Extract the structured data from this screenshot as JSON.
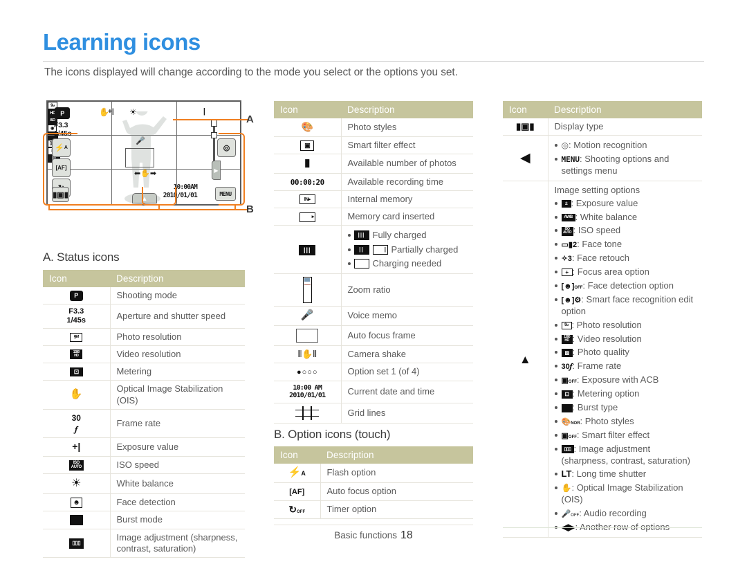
{
  "page": {
    "title": "Learning icons",
    "intro": "The icons displayed will change according to the mode you select or the options you set.",
    "footer_label": "Basic functions",
    "footer_page": "18",
    "accent_color": "#2f8fe0",
    "callout_color": "#f07f20",
    "table_header_color": "#c6c59d"
  },
  "camera_screen": {
    "mode_badge": "P",
    "aperture": "F3.3",
    "shutter": "1/45s",
    "time": "10:00AM",
    "date": "2010/01/01",
    "menu_button": "MENU",
    "motion_button": "motion-recognition",
    "flash_button": "A",
    "af_button": "AF",
    "timer_button": "OFF",
    "display_button": "display-type",
    "callout_a": "A",
    "callout_b": "B"
  },
  "sections": {
    "a_heading": "A. Status icons",
    "b_heading": "B. Option icons (touch)"
  },
  "table_headers": {
    "icon": "Icon",
    "description": "Description"
  },
  "status_icons": [
    {
      "icon": "shooting-mode",
      "text": "Shooting mode"
    },
    {
      "icon": "aperture-shutter",
      "text": "Aperture and shutter speed"
    },
    {
      "icon": "photo-resolution",
      "text": "Photo resolution"
    },
    {
      "icon": "video-resolution",
      "text": "Video resolution"
    },
    {
      "icon": "metering",
      "text": "Metering"
    },
    {
      "icon": "ois",
      "text": "Optical Image Stabilization (OIS)"
    },
    {
      "icon": "frame-rate",
      "text": "Frame rate"
    },
    {
      "icon": "exposure-value",
      "text": "Exposure value"
    },
    {
      "icon": "iso-speed",
      "text": "ISO speed"
    },
    {
      "icon": "white-balance",
      "text": "White balance"
    },
    {
      "icon": "face-detection",
      "text": "Face detection"
    },
    {
      "icon": "burst-mode",
      "text": "Burst mode"
    },
    {
      "icon": "image-adjust",
      "text": "Image adjustment (sharpness, contrast, saturation)"
    }
  ],
  "middle_icons": [
    {
      "icon": "photo-styles",
      "text": "Photo styles"
    },
    {
      "icon": "smart-filter",
      "text": "Smart filter effect"
    },
    {
      "icon": "available-photos",
      "text": "Available number of photos"
    },
    {
      "icon": "recording-time",
      "text": "Available recording time",
      "icon_text": "00:00:20"
    },
    {
      "icon": "internal-memory",
      "text": "Internal memory"
    },
    {
      "icon": "memory-card",
      "text": "Memory card inserted"
    },
    {
      "icon": "battery",
      "text": "",
      "sub": [
        {
          "label": "Fully charged"
        },
        {
          "label": "Partially charged"
        },
        {
          "label": "Charging needed"
        }
      ]
    },
    {
      "icon": "zoom-ratio",
      "text": "Zoom ratio"
    },
    {
      "icon": "voice-memo",
      "text": "Voice memo"
    },
    {
      "icon": "auto-focus-frame",
      "text": "Auto focus frame"
    },
    {
      "icon": "camera-shake",
      "text": "Camera shake"
    },
    {
      "icon": "option-set",
      "text": "Option set 1 (of 4)"
    },
    {
      "icon": "date-time",
      "text": "Current date and time",
      "icon_text_1": "10:00 AM",
      "icon_text_2": "2010/01/01"
    },
    {
      "icon": "grid-lines",
      "text": "Grid lines"
    }
  ],
  "option_icons": [
    {
      "icon": "flash-option",
      "text": "Flash option"
    },
    {
      "icon": "auto-focus-option",
      "text": "Auto focus option"
    },
    {
      "icon": "timer-option",
      "text": "Timer option"
    }
  ],
  "right_icons": [
    {
      "icon": "display-type",
      "text": "Display type"
    },
    {
      "icon": "left-arrow",
      "sub": [
        {
          "icon": "motion-recognition",
          "text": "Motion recognition"
        },
        {
          "icon": "menu",
          "text": "Shooting options and settings menu"
        }
      ]
    },
    {
      "icon": "up-arrow",
      "intro": "Image setting options",
      "sub": [
        {
          "icon": "exposure-value",
          "text": "Exposure value"
        },
        {
          "icon": "white-balance-awb",
          "text": "White balance"
        },
        {
          "icon": "iso-speed",
          "text": "ISO speed"
        },
        {
          "icon": "face-tone",
          "text": "Face tone"
        },
        {
          "icon": "face-retouch",
          "text": "Face retouch"
        },
        {
          "icon": "focus-area",
          "text": "Focus area option"
        },
        {
          "icon": "face-detection-option",
          "text": "Face detection option"
        },
        {
          "icon": "smart-face-recognition",
          "text": "Smart face recognition edit option"
        },
        {
          "icon": "photo-resolution",
          "text": "Photo resolution"
        },
        {
          "icon": "video-resolution",
          "text": "Video resolution"
        },
        {
          "icon": "photo-quality",
          "text": "Photo quality"
        },
        {
          "icon": "frame-rate",
          "text": "Frame rate"
        },
        {
          "icon": "exposure-acb",
          "text": "Exposure with ACB"
        },
        {
          "icon": "metering-option",
          "text": "Metering option"
        },
        {
          "icon": "burst-type",
          "text": "Burst type"
        },
        {
          "icon": "photo-styles-nor",
          "text": "Photo styles"
        },
        {
          "icon": "smart-filter-off",
          "text": "Smart filter effect"
        },
        {
          "icon": "image-adjust",
          "text": "Image adjustment (sharpness, contrast, saturation)"
        },
        {
          "icon": "long-time-shutter",
          "text": "Long time shutter"
        },
        {
          "icon": "ois",
          "text": "Optical Image Stabilization (OIS)"
        },
        {
          "icon": "audio-recording",
          "text": "Audio recording"
        },
        {
          "icon": "another-row",
          "text": "Another row of options"
        }
      ]
    }
  ]
}
